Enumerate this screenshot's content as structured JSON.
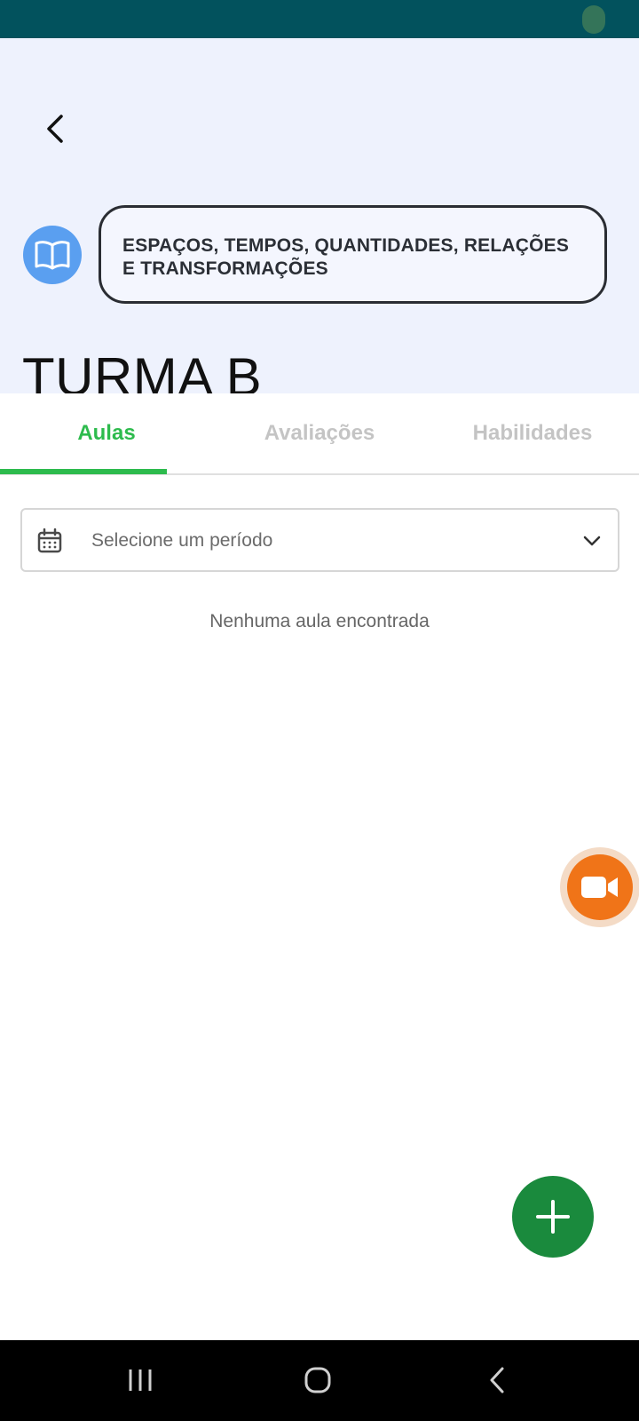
{
  "header": {
    "subject": "ESPAÇOS, TEMPOS, QUANTIDADES, RELAÇÕES E TRANSFORMAÇÕES",
    "title": "TURMA B"
  },
  "tabs": [
    {
      "label": "Aulas",
      "active": true
    },
    {
      "label": "Avaliações",
      "active": false
    },
    {
      "label": "Habilidades",
      "active": false
    }
  ],
  "period_select": {
    "placeholder": "Selecione um período"
  },
  "empty_message": "Nenhuma aula encontrada",
  "colors": {
    "status_bar": "#02525d",
    "header_bg": "#eef2fd",
    "accent_green": "#2dbb4d",
    "fab_green": "#1a8a3d",
    "video_orange": "#f07418",
    "subject_blue": "#5a9ff0"
  },
  "icons": {
    "back": "back-arrow-icon",
    "subject": "book-open-icon",
    "calendar": "calendar-icon",
    "dropdown": "chevron-down-icon",
    "video": "video-camera-icon",
    "add": "plus-icon",
    "nav_recent": "recent-apps-icon",
    "nav_home": "home-icon",
    "nav_back": "nav-back-icon"
  }
}
